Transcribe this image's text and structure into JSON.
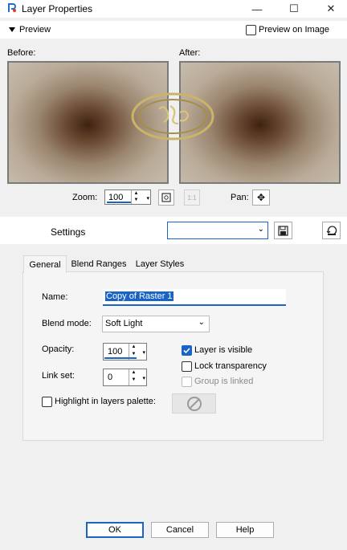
{
  "window": {
    "title": "Layer Properties",
    "minimize_glyph": "—",
    "maximize_glyph": "☐",
    "close_glyph": "✕"
  },
  "preview": {
    "toggle_label": "Preview",
    "preview_on_image_label": "Preview on Image",
    "preview_on_image_checked": false,
    "before_label": "Before:",
    "after_label": "After:",
    "zoom_label": "Zoom:",
    "zoom_value": "100",
    "pan_label": "Pan:",
    "pan_glyph": "✥"
  },
  "settings": {
    "label": "Settings",
    "value": ""
  },
  "tabs": [
    {
      "label": "General",
      "active": true
    },
    {
      "label": "Blend Ranges",
      "active": false
    },
    {
      "label": "Layer Styles",
      "active": false
    }
  ],
  "general": {
    "name_label": "Name:",
    "name_value": "Copy of Raster 1",
    "blend_label": "Blend mode:",
    "blend_value": "Soft Light",
    "opacity_label": "Opacity:",
    "opacity_value": "100",
    "linkset_label": "Link set:",
    "linkset_value": "0",
    "layer_visible_label": "Layer is visible",
    "layer_visible_checked": true,
    "lock_transparency_label": "Lock transparency",
    "lock_transparency_checked": false,
    "group_linked_label": "Group is linked",
    "group_linked_checked": false,
    "highlight_label": "Highlight in layers palette:",
    "highlight_checked": false
  },
  "buttons": {
    "ok": "OK",
    "cancel": "Cancel",
    "help": "Help"
  },
  "colors": {
    "accent": "#1a64c6"
  }
}
